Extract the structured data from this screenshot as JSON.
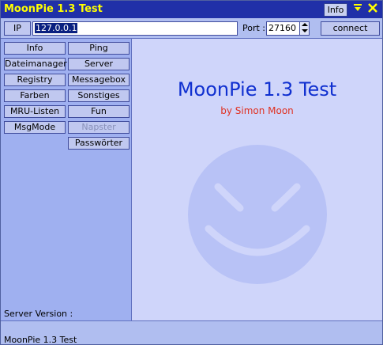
{
  "window": {
    "title": "MoonPie 1.3 Test"
  },
  "titlebar": {
    "info_label": "Info",
    "minimize_icon": "minimize-icon",
    "close_icon": "close-icon"
  },
  "connection": {
    "ip_label": "IP",
    "ip_value": "127.0.0.1",
    "port_label": "Port :",
    "port_value": "27160",
    "connect_label": "connect"
  },
  "nav": {
    "left": [
      "Info",
      "Dateimanager",
      "Registry",
      "Farben",
      "MRU-Listen",
      "MsgMode"
    ],
    "right": [
      "Ping",
      "Server",
      "Messagebox",
      "Sonstiges",
      "Fun",
      "Napster",
      "Passwörter"
    ],
    "disabled": [
      "Napster"
    ]
  },
  "main": {
    "title": "MoonPie 1.3 Test",
    "subtitle": "by Simon Moon",
    "graphic": "moon-smiley"
  },
  "server_version_label": "Server Version :",
  "status": {
    "text": "MoonPie 1.3 Test"
  },
  "colors": {
    "titlebar": "#2030a8",
    "title_text": "#ffff00",
    "main_title": "#1030d0",
    "subtitle": "#e03020",
    "left_panel": "#9fb0f0",
    "main_panel": "#cfd5fa"
  }
}
